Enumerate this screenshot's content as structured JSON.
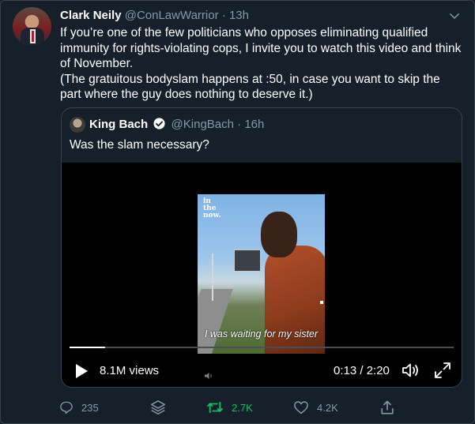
{
  "tweet": {
    "author_name": "Clark Neily",
    "author_handle": "@ConLawWarrior",
    "separator": "·",
    "time": "13h",
    "text_line1": "If you’re one of the few politicians who opposes eliminating qualified immunity for rights-violating cops, I invite you to watch this video and think of November.",
    "text_line2": "(The gratuitous bodyslam happens at :50, in case you want to skip the part where the guy does nothing to deserve it.)"
  },
  "quoted": {
    "author_name": "King Bach",
    "author_handle": "@KingBach",
    "separator": "·",
    "time": "16h",
    "text": "Was the slam necessary?",
    "verified": true
  },
  "video": {
    "wordmark_line1": "in",
    "wordmark_line2": "the",
    "wordmark_line3": "now.",
    "caption": "I was waiting for my sister",
    "views": "8.1M views",
    "time_display": "0:13 / 2:20",
    "progress_fraction": 0.093
  },
  "actions": {
    "reply_count": "235",
    "retweet_count": "2.7K",
    "like_count": "4.2K",
    "retweet_color": "#17bf63",
    "muted_color": "#8899a6"
  },
  "icons": [
    "chevron-down-icon",
    "verified-badge-icon",
    "play-icon",
    "volume-icon",
    "fullscreen-icon",
    "reply-icon",
    "stack-icon",
    "retweet-icon",
    "like-icon",
    "share-icon"
  ]
}
